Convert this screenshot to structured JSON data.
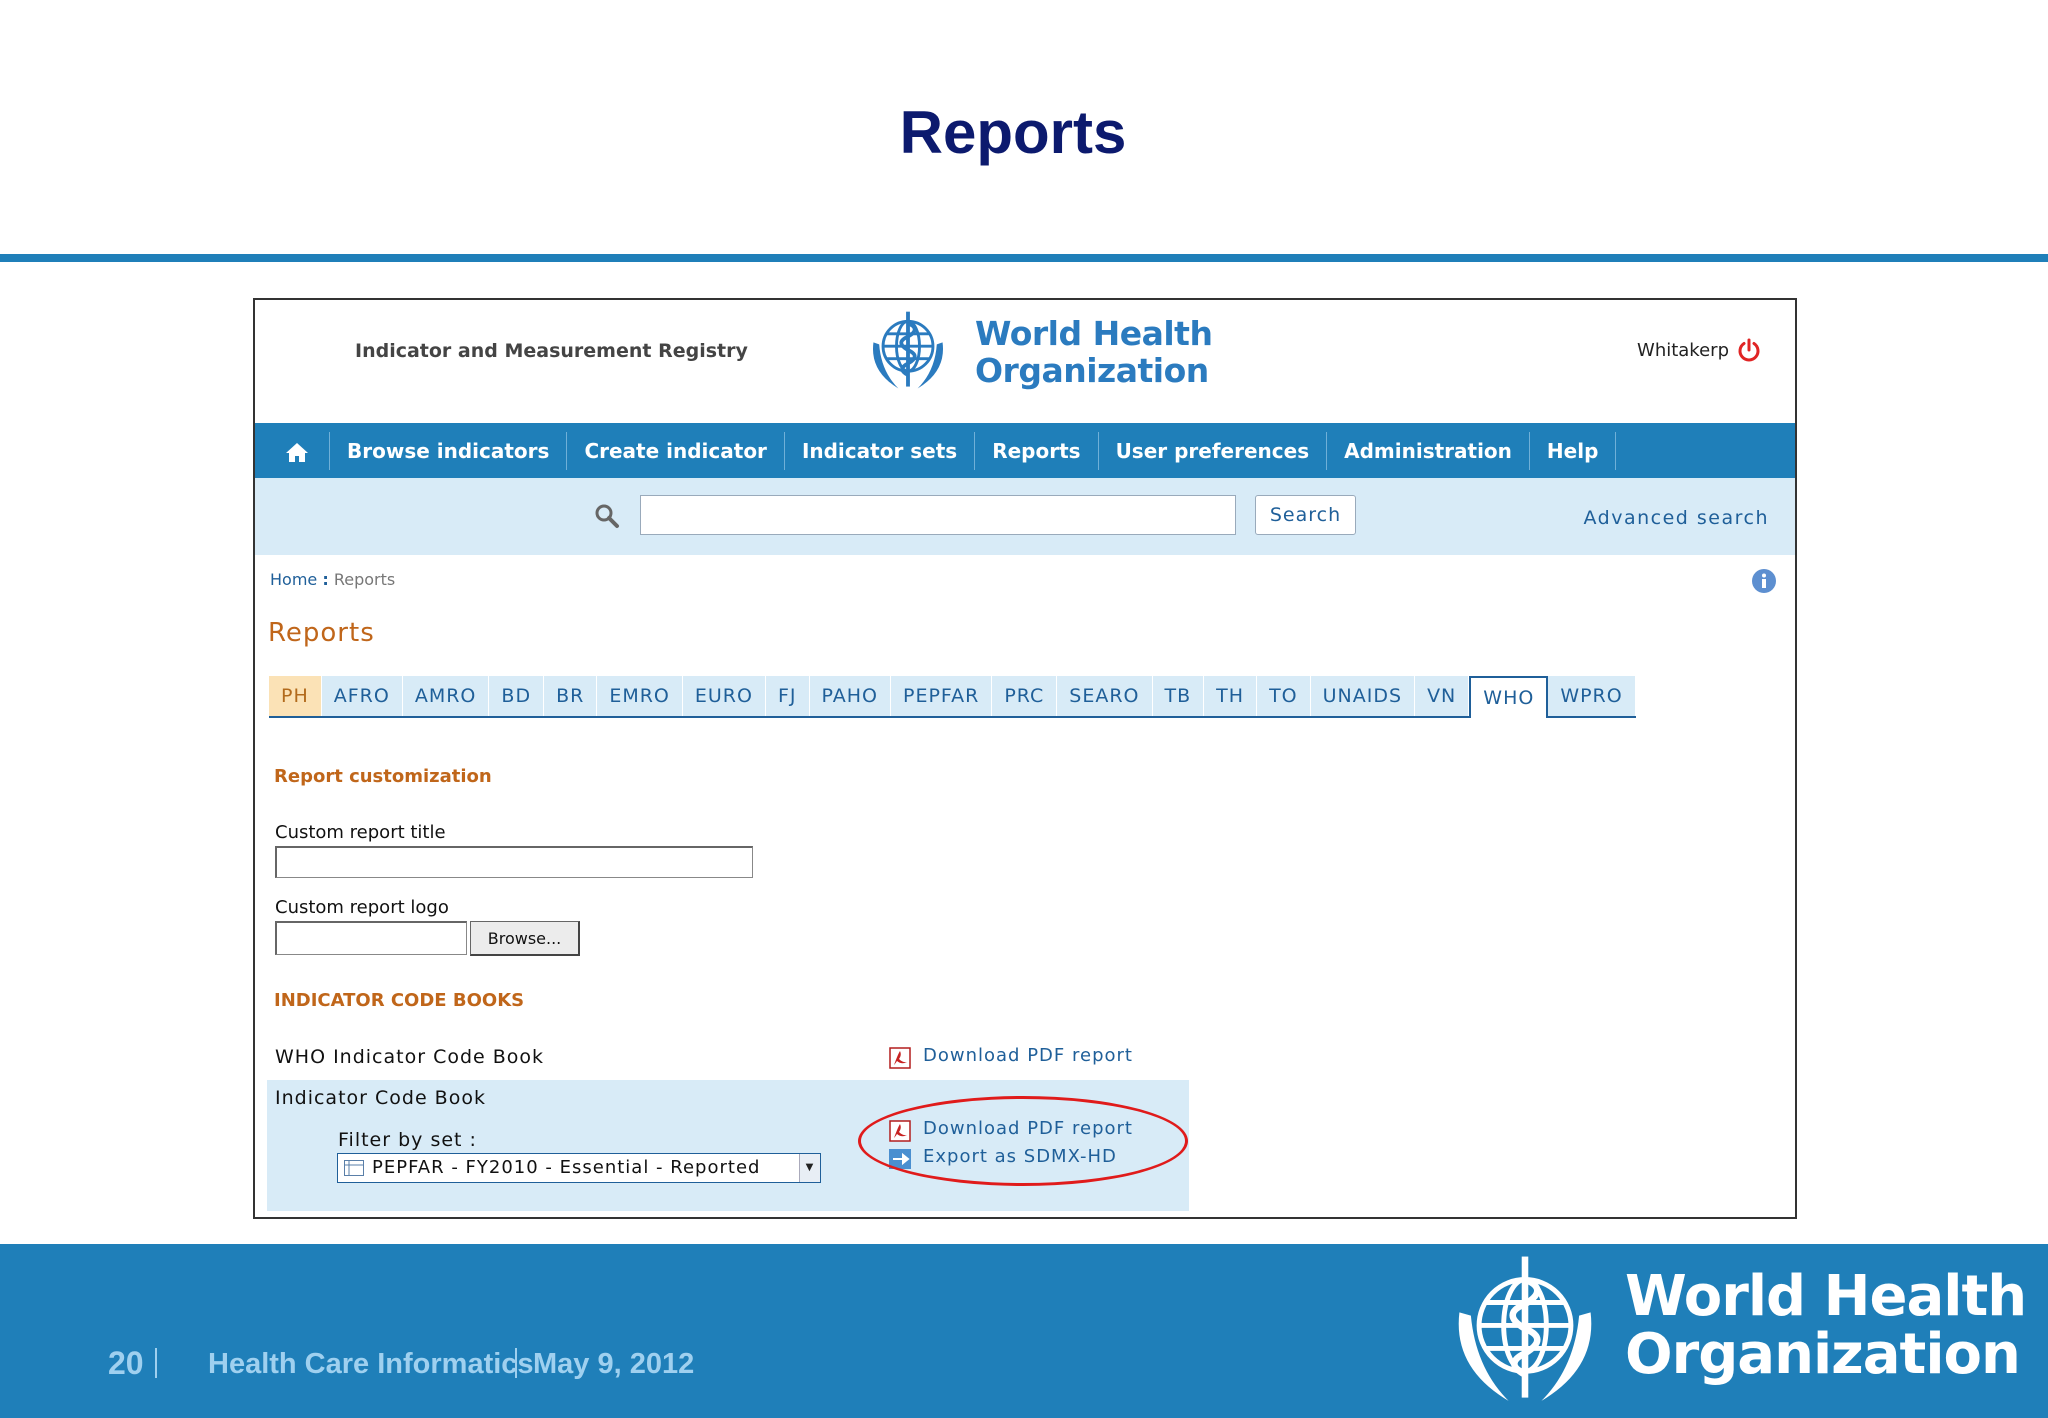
{
  "slide": {
    "title": "Reports",
    "footer": {
      "page_number": "20",
      "course": "Health Care Informatics",
      "date": "May 9, 2012",
      "logo_text_line1": "World Health",
      "logo_text_line2": "Organization"
    }
  },
  "app": {
    "name": "Indicator and Measurement Registry",
    "logo_text_line1": "World Health",
    "logo_text_line2": "Organization",
    "username": "Whitakerp",
    "nav": {
      "home_icon": "home-icon",
      "items": [
        {
          "label": "Browse indicators"
        },
        {
          "label": "Create indicator"
        },
        {
          "label": "Indicator sets"
        },
        {
          "label": "Reports"
        },
        {
          "label": "User preferences"
        },
        {
          "label": "Administration"
        },
        {
          "label": "Help"
        }
      ]
    },
    "search": {
      "value": "",
      "button_label": "Search",
      "advanced_label": "Advanced search"
    },
    "breadcrumb": {
      "home": "Home",
      "separator": ":",
      "current": "Reports"
    },
    "page_heading": "Reports",
    "tabs": [
      {
        "label": "PH"
      },
      {
        "label": "AFRO"
      },
      {
        "label": "AMRO"
      },
      {
        "label": "BD"
      },
      {
        "label": "BR"
      },
      {
        "label": "EMRO"
      },
      {
        "label": "EURO"
      },
      {
        "label": "FJ"
      },
      {
        "label": "PAHO"
      },
      {
        "label": "PEPFAR"
      },
      {
        "label": "PRC"
      },
      {
        "label": "SEARO"
      },
      {
        "label": "TB"
      },
      {
        "label": "TH"
      },
      {
        "label": "TO"
      },
      {
        "label": "UNAIDS"
      },
      {
        "label": "VN"
      },
      {
        "label": "WHO"
      },
      {
        "label": "WPRO"
      }
    ],
    "active_tab": "WHO",
    "customization": {
      "heading": "Report customization",
      "title_label": "Custom report title",
      "title_value": "",
      "logo_label": "Custom report logo",
      "logo_value": "",
      "browse_label": "Browse..."
    },
    "code_books": {
      "heading": "INDICATOR CODE BOOKS",
      "who_book_label": "WHO Indicator Code Book",
      "who_book_link": "Download PDF report",
      "book_label": "Indicator Code Book",
      "filter_label": "Filter by set :",
      "filter_selected": "PEPFAR - FY2010 - Essential - Reported",
      "book_link_pdf": "Download PDF report",
      "book_link_sdmx": "Export as SDMX-HD"
    }
  },
  "colors": {
    "brand_blue": "#1f7fb9",
    "title_navy": "#0c1a6e",
    "orange": "#c0661a",
    "highlight_red": "#e01b1b"
  }
}
